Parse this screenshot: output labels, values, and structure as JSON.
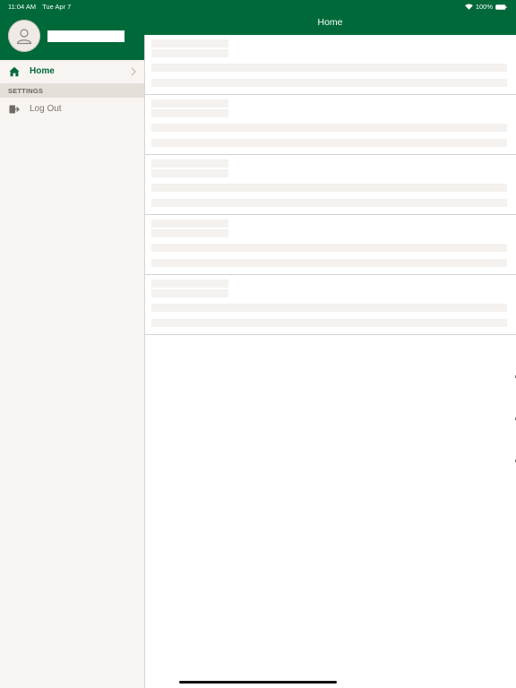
{
  "status_bar": {
    "time": "11:04 AM",
    "date": "Tue Apr 7",
    "battery": "100%"
  },
  "sidebar": {
    "user_name": "",
    "items": [
      {
        "label": "Home",
        "icon": "home-icon",
        "selected": true
      }
    ],
    "section_title": "SETTINGS",
    "settings_items": [
      {
        "label": "Log Out",
        "icon": "logout-icon"
      }
    ]
  },
  "nav_bar": {
    "title": "Home"
  },
  "colors": {
    "brand_green": "#00693a",
    "sidebar_bg": "#f8f4f1",
    "section_bg": "#e5dfd9",
    "skeleton": "#f4f1ee"
  }
}
